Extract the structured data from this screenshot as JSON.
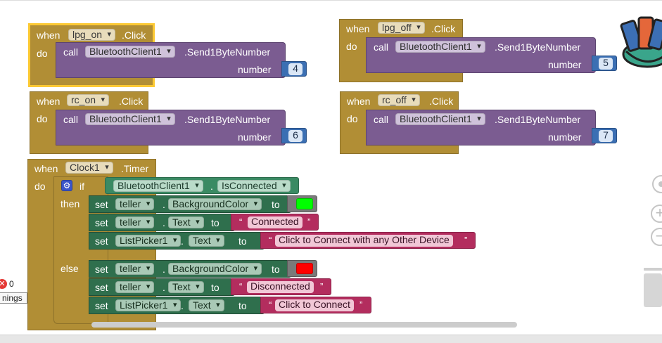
{
  "events": [
    {
      "kw_when": "when",
      "component": "lpg_on",
      "event": ".Click",
      "kw_do": "do",
      "call": {
        "kw": "call",
        "component": "BluetoothClient1",
        "method": ".Send1ByteNumber",
        "param": "number",
        "value": "4"
      }
    },
    {
      "kw_when": "when",
      "component": "lpg_off",
      "event": ".Click",
      "kw_do": "do",
      "call": {
        "kw": "call",
        "component": "BluetoothClient1",
        "method": ".Send1ByteNumber",
        "param": "number",
        "value": "5"
      }
    },
    {
      "kw_when": "when",
      "component": "rc_on",
      "event": ".Click",
      "kw_do": "do",
      "call": {
        "kw": "call",
        "component": "BluetoothClient1",
        "method": ".Send1ByteNumber",
        "param": "number",
        "value": "6"
      }
    },
    {
      "kw_when": "when",
      "component": "rc_off",
      "event": ".Click",
      "kw_do": "do",
      "call": {
        "kw": "call",
        "component": "BluetoothClient1",
        "method": ".Send1ByteNumber",
        "param": "number",
        "value": "7"
      }
    }
  ],
  "timer": {
    "kw_when": "when",
    "component": "Clock1",
    "event": ".Timer",
    "kw_do": "do",
    "kw_if": "if",
    "kw_then": "then",
    "kw_else": "else",
    "condition": {
      "component": "BluetoothClient1",
      "dot": ".",
      "property": "IsConnected"
    },
    "then": [
      {
        "kw": "set",
        "component": "teller",
        "dot": ".",
        "property": "BackgroundColor",
        "to": "to",
        "color": "#00ff00"
      },
      {
        "kw": "set",
        "component": "teller",
        "dot": ".",
        "property": "Text",
        "to": "to",
        "text": "Connected"
      },
      {
        "kw": "set",
        "component": "ListPicker1",
        "dot": ".",
        "property": "Text",
        "to": "to",
        "text": "Click to Connect with any Other Device"
      }
    ],
    "else": [
      {
        "kw": "set",
        "component": "teller",
        "dot": ".",
        "property": "BackgroundColor",
        "to": "to",
        "color": "#ff0000"
      },
      {
        "kw": "set",
        "component": "teller",
        "dot": ".",
        "property": "Text",
        "to": "to",
        "text": "Disconnected"
      },
      {
        "kw": "set",
        "component": "ListPicker1",
        "dot": ".",
        "property": "Text",
        "to": "to",
        "text": "Click to Connect"
      }
    ]
  },
  "quotes": {
    "open": "“",
    "close": "”"
  },
  "warnings": {
    "error_count": "0",
    "toggle_label": "nings"
  },
  "zoom": {
    "in": "+",
    "out": "−"
  },
  "colors": {
    "event": "#b18e35",
    "procedure": "#7b5c91",
    "component": "#3a8a63",
    "setter": "#2f6f4d",
    "text": "#b32d5e",
    "number": "#3b6fb3",
    "selected_outline": "#fcc933"
  },
  "icons": [
    "backpack-icon",
    "gear-icon",
    "recenter-icon",
    "zoom-in-icon",
    "zoom-out-icon",
    "trash-icon",
    "error-icon"
  ]
}
